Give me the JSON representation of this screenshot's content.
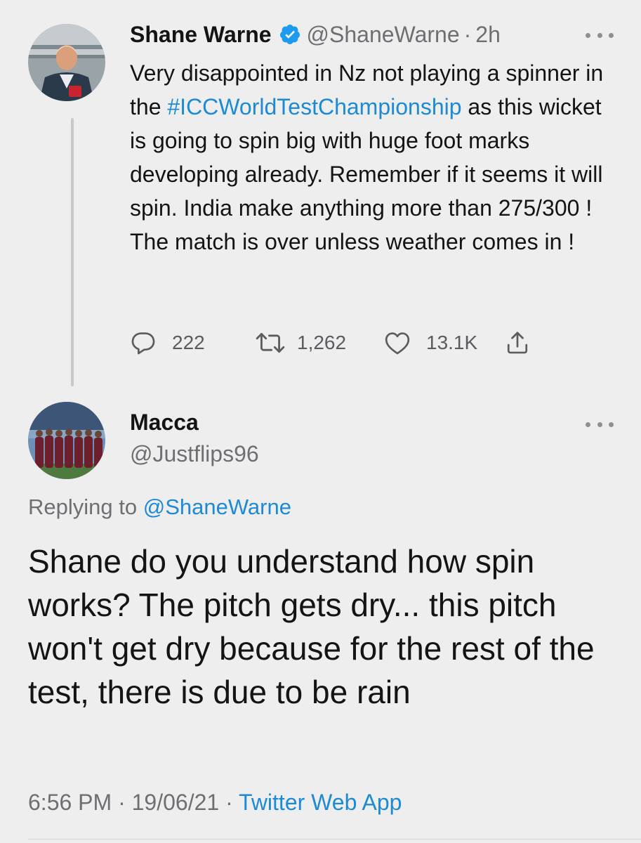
{
  "parent_tweet": {
    "author_name": "Shane Warne",
    "handle": "@ShaneWarne",
    "separator": "·",
    "time_ago": "2h",
    "text_before_hashtag": "Very disappointed in Nz not playing a spinner in the ",
    "hashtag": "#ICCWorldTestChampionship",
    "text_after_hashtag": " as this wicket is going to spin big with huge foot marks developing already. Remember if it seems it will spin. India make anything more than 275/300 ! The match is over unless weather comes in !",
    "reply_count": "222",
    "retweet_count": "1,262",
    "like_count": "13.1K"
  },
  "reply_tweet": {
    "author_name": "Macca",
    "handle": "@Justflips96",
    "replying_to_prefix": "Replying to ",
    "replying_to_handle": "@ShaneWarne",
    "text": "Shane do you understand how spin works? The pitch gets dry... this pitch won't get dry because for the rest of the test, there is due to be rain",
    "time": "6:56 PM",
    "date": "19/06/21",
    "separator": "·",
    "source": "Twitter Web App"
  },
  "colors": {
    "background": "#efeeef",
    "link": "#1d8ad6",
    "secondary_text": "#6f6f73",
    "verified_badge": "#1d9bf0"
  },
  "icons": {
    "reply": "reply-icon",
    "retweet": "retweet-icon",
    "like": "like-icon",
    "share": "share-icon",
    "more": "more-icon",
    "verified": "verified-badge-icon"
  }
}
